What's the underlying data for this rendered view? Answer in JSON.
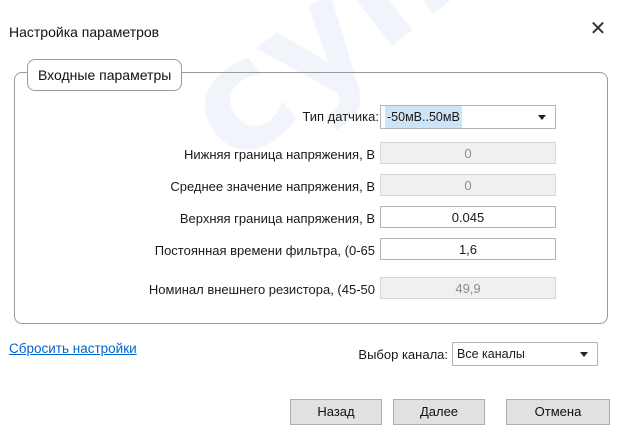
{
  "window": {
    "title": "Настройка параметров",
    "close_symbol": "✕"
  },
  "group": {
    "label": "Входные параметры"
  },
  "sensor": {
    "label": "Тип датчика:",
    "value": "-50мВ..50мВ"
  },
  "rows": [
    {
      "label": "Нижняя граница напряжения, В",
      "value": "0",
      "enabled": false
    },
    {
      "label": "Среднее значение напряжения, В",
      "value": "0",
      "enabled": false
    },
    {
      "label": "Верхняя граница напряжения, В",
      "value": "0.045",
      "enabled": true
    },
    {
      "label": "Постоянная времени фильтра, (0-65",
      "value": "1,6",
      "enabled": true
    },
    {
      "label": "Номинал внешнего резистора, (45-50",
      "value": "49,9",
      "enabled": false
    }
  ],
  "reset_link": "Сбросить настройки",
  "channel": {
    "label": "Выбор канала:",
    "value": "Все каналы"
  },
  "buttons": {
    "back": "Назад",
    "next": "Далее",
    "cancel": "Отмена"
  },
  "watermark": "супер",
  "icons": {
    "close": "close-icon",
    "dropdown": "chevron-down-icon"
  }
}
